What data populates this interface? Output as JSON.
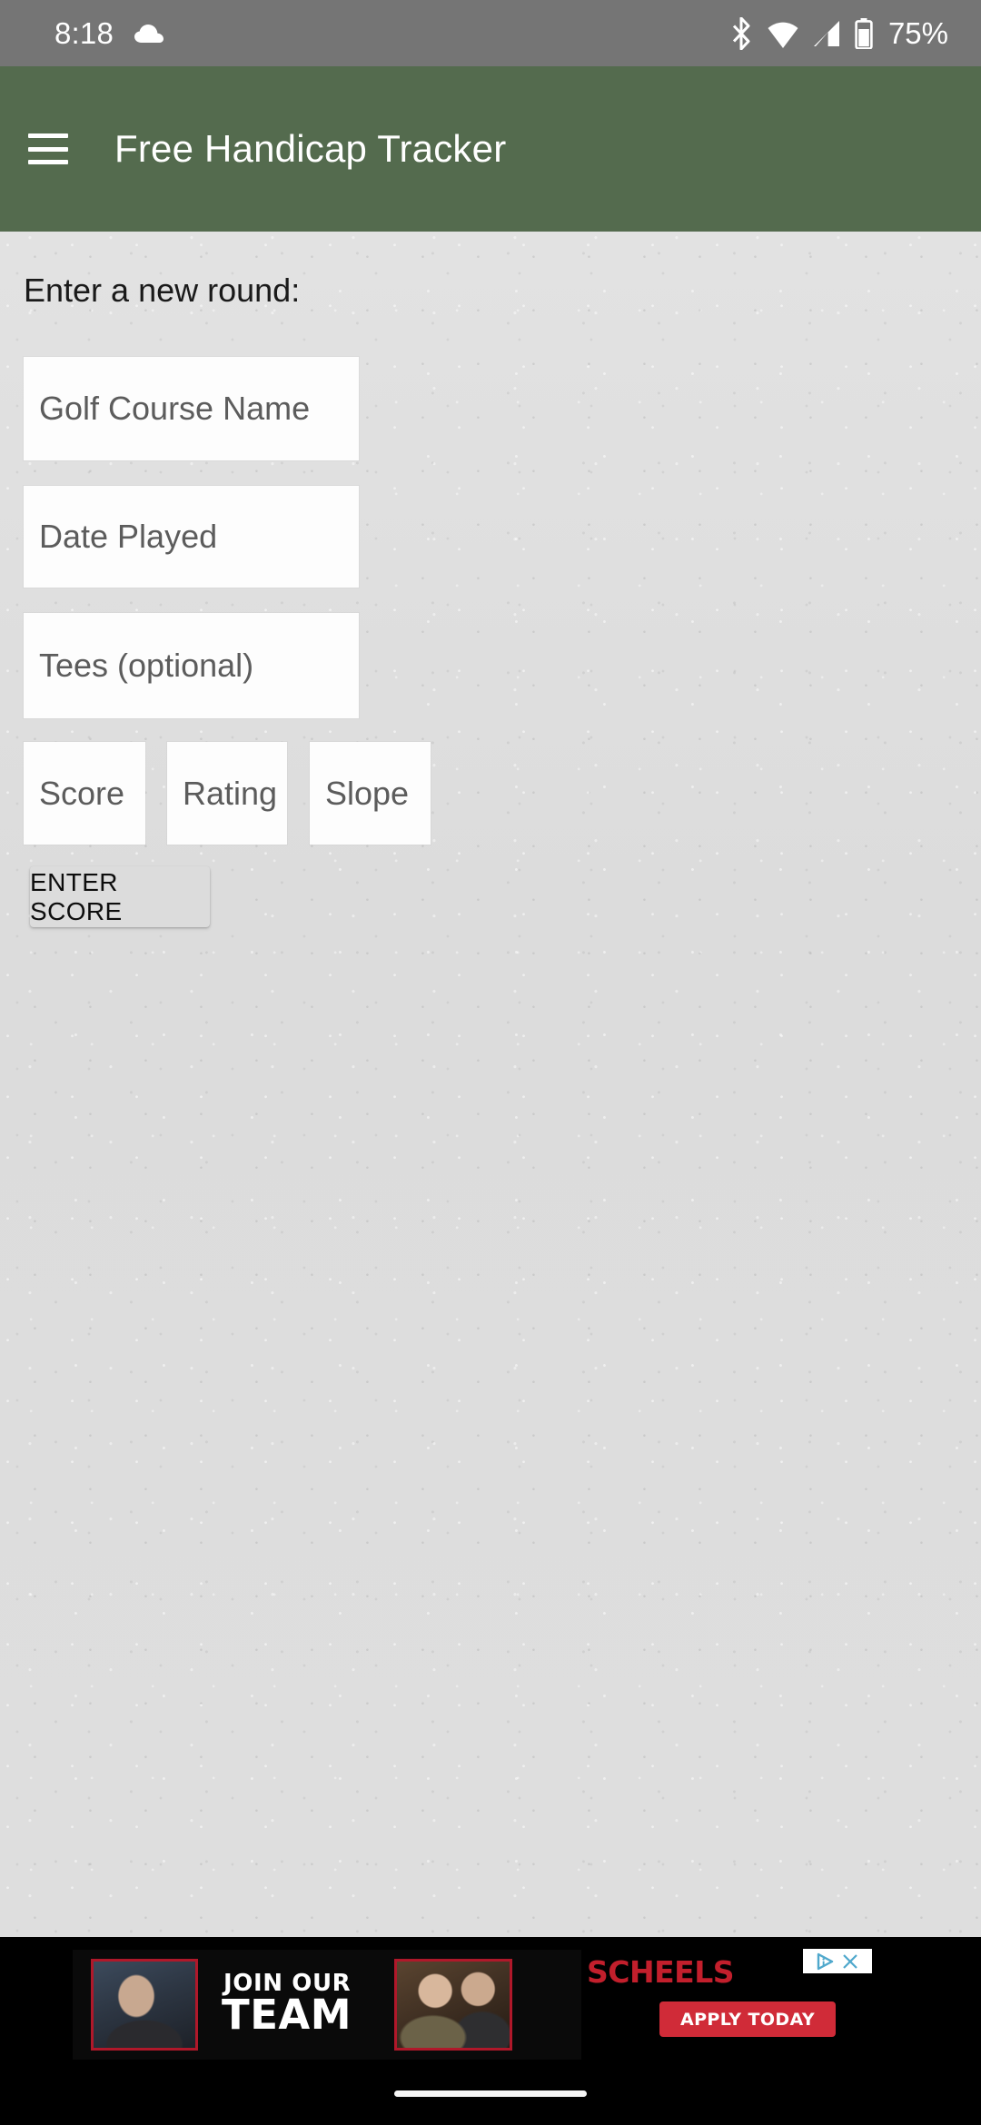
{
  "status_bar": {
    "time": "8:18",
    "battery_percent": "75%",
    "icons": [
      "cloud-icon",
      "bluetooth-icon",
      "wifi-icon",
      "cell-signal-icon",
      "battery-icon"
    ],
    "background_color": "#757575",
    "foreground_color": "#ffffff"
  },
  "app_bar": {
    "title": "Free Handicap Tracker",
    "menu_icon": "hamburger-menu-icon",
    "background_color": "#546B4E",
    "text_color": "#ffffff"
  },
  "main": {
    "section_label": "Enter a new round:",
    "background_color": "#dedede",
    "fields": [
      {
        "name": "course",
        "placeholder": "Golf Course Name",
        "value": ""
      },
      {
        "name": "date",
        "placeholder": "Date Played",
        "value": ""
      },
      {
        "name": "tees",
        "placeholder": "Tees (optional)",
        "value": ""
      },
      {
        "name": "score",
        "placeholder": "Score",
        "value": ""
      },
      {
        "name": "rating",
        "placeholder": "Rating",
        "value": ""
      },
      {
        "name": "slope",
        "placeholder": "Slope",
        "value": ""
      }
    ],
    "submit_button": {
      "label": "ENTER SCORE",
      "background_color": "#dcdcdc",
      "text_color": "#0d0d0d"
    }
  },
  "ad": {
    "headline_line1": "JOIN OUR",
    "headline_line2": "TEAM",
    "brand": "SCHEELS",
    "cta_label": "APPLY TODAY",
    "adchoices_icon": "adchoices-triangle-icon",
    "close_icon": "close-icon",
    "background_color": "#0a0a0a",
    "brand_color": "#c21f2c",
    "cta_color": "#d02b38"
  },
  "nav_bar": {
    "gesture_handle": "gesture-pill",
    "background_color": "#000000"
  }
}
